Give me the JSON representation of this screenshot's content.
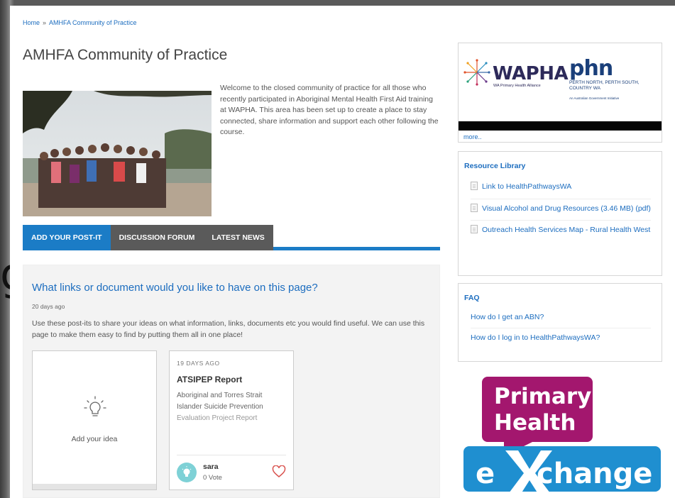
{
  "background": {
    "partial_glyph": "g"
  },
  "breadcrumb": {
    "home": "Home",
    "separator": "»",
    "current": "AMHFA Community of Practice"
  },
  "page": {
    "title": "AMHFA Community of Practice",
    "intro": "Welcome to the closed community of practice for all those who recently participated in Aboriginal Mental Health First Aid training at WAPHA. This area has been set up to create a place to stay connected, share information and support each other following the course."
  },
  "tabs": [
    {
      "label": "ADD YOUR POST-IT",
      "active": true
    },
    {
      "label": "DISCUSSION FORUM",
      "active": false
    },
    {
      "label": "LATEST NEWS",
      "active": false
    }
  ],
  "question": {
    "title": "What links or document would you like to have on this page?",
    "age": "20 days ago",
    "description": "Use these post-its to share your ideas on what information, links, documents etc you would find useful. We can use this page to make them easy to find by putting them all in one place!"
  },
  "add_card": {
    "label": "Add your idea",
    "icon": "lightbulb-icon"
  },
  "post_card": {
    "date": "19 DAYS AGO",
    "title": "ATSIPEP Report",
    "body_lines": [
      "Aboriginal and Torres Strait",
      "Islander Suicide Prevention",
      "Evaluation Project Report"
    ],
    "user": "sara",
    "votes": "0 Vote",
    "heart_color": "#d9534f"
  },
  "sidebar": {
    "logos": {
      "wapha": "WAPHA",
      "wapha_sub": "WA Primary Health Alliance",
      "phn": "phn",
      "phn_sub": "PERTH NORTH, PERTH SOUTH, COUNTRY WA",
      "phn_gov": "An Australian Government Initiative",
      "more": "more.."
    },
    "resources": {
      "heading": "Resource Library",
      "items": [
        "Link to HealthPathwaysWA",
        "Visual Alcohol and Drug Resources (3.46 MB) (pdf)",
        "Outreach Health Services Map - Rural Health West"
      ]
    },
    "faq": {
      "heading": "FAQ",
      "items": [
        "How do I get an ABN?",
        "How do I log in to HealthPathwaysWA?"
      ]
    },
    "banner": {
      "line1": "Primary",
      "line2": "Health",
      "line3a": "e",
      "line3b": "change",
      "magenta": "#a3176e",
      "blue": "#1f8fd0"
    }
  },
  "colors": {
    "accent_blue": "#1b7cc6",
    "link_blue": "#1c6dbf",
    "tab_grey": "#5a5a5a"
  }
}
